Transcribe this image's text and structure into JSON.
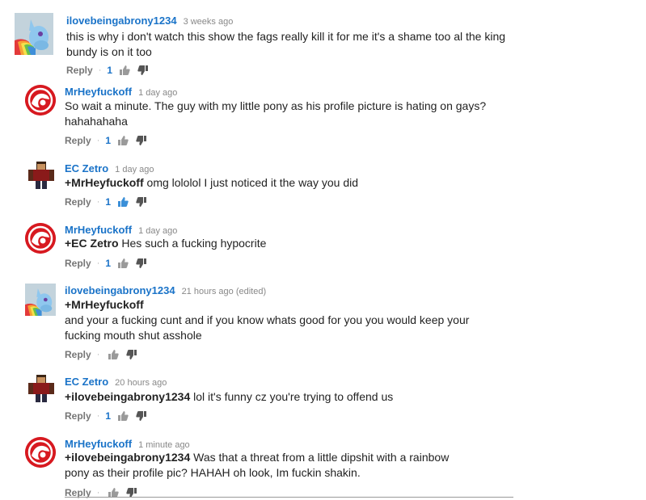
{
  "comments": [
    {
      "author": "ilovebeingabrony1234",
      "time": "3 weeks ago",
      "mention": "",
      "text_lines": [
        "this is why i don't watch this show the fags really kill it for me it's a shame too al the king",
        "bundy is on it too"
      ],
      "reply_label": "Reply",
      "likes": "1",
      "avatar": "pony-avatar"
    },
    {
      "author": "MrHeyfuckoff",
      "time": "1 day ago",
      "mention": "",
      "text_lines": [
        "So wait a minute. The guy with my little pony as his profile picture is hating on gays?",
        "hahahahaha"
      ],
      "reply_label": "Reply",
      "likes": "1",
      "avatar": "holden-logo-avatar"
    },
    {
      "author": "EC Zetro",
      "time": "1 day ago",
      "mention": "+MrHeyfuckoff",
      "text_lines": [
        " omg lololol I just noticed it the way you did"
      ],
      "reply_label": "Reply",
      "likes": "1",
      "avatar": "minecraft-skin-avatar"
    },
    {
      "author": "MrHeyfuckoff",
      "time": "1 day ago",
      "mention": "+EC Zetro",
      "text_lines": [
        " Hes such a fucking hypocrite"
      ],
      "reply_label": "Reply",
      "likes": "1",
      "avatar": "holden-logo-avatar"
    },
    {
      "author": "ilovebeingabrony1234",
      "time": "21 hours ago (edited)",
      "mention": "+MrHeyfuckoff",
      "text_lines": [
        "",
        "and your a fucking cunt and if you know whats good for you you would keep your",
        "fucking mouth shut asshole"
      ],
      "reply_label": "Reply",
      "likes": "",
      "avatar": "pony-avatar"
    },
    {
      "author": "EC Zetro",
      "time": "20 hours ago",
      "mention": "+ilovebeingabrony1234",
      "text_lines": [
        " lol it's funny cz you're trying to offend us"
      ],
      "reply_label": "Reply",
      "likes": "1",
      "avatar": "minecraft-skin-avatar"
    },
    {
      "author": "MrHeyfuckoff",
      "time": "1 minute ago",
      "mention": "+ilovebeingabrony1234",
      "text_lines": [
        " Was that a threat from a little dipshit with a rainbow",
        "pony as their profile pic? HAHAH oh look, Im fuckin shakin."
      ],
      "reply_label": "Reply",
      "likes": "",
      "avatar": "holden-logo-avatar"
    }
  ],
  "separator": "·",
  "colors": {
    "author": "#1a73c8",
    "meta": "#888888",
    "text": "#222222",
    "reply": "#767676",
    "holden_red": "#d71920"
  }
}
